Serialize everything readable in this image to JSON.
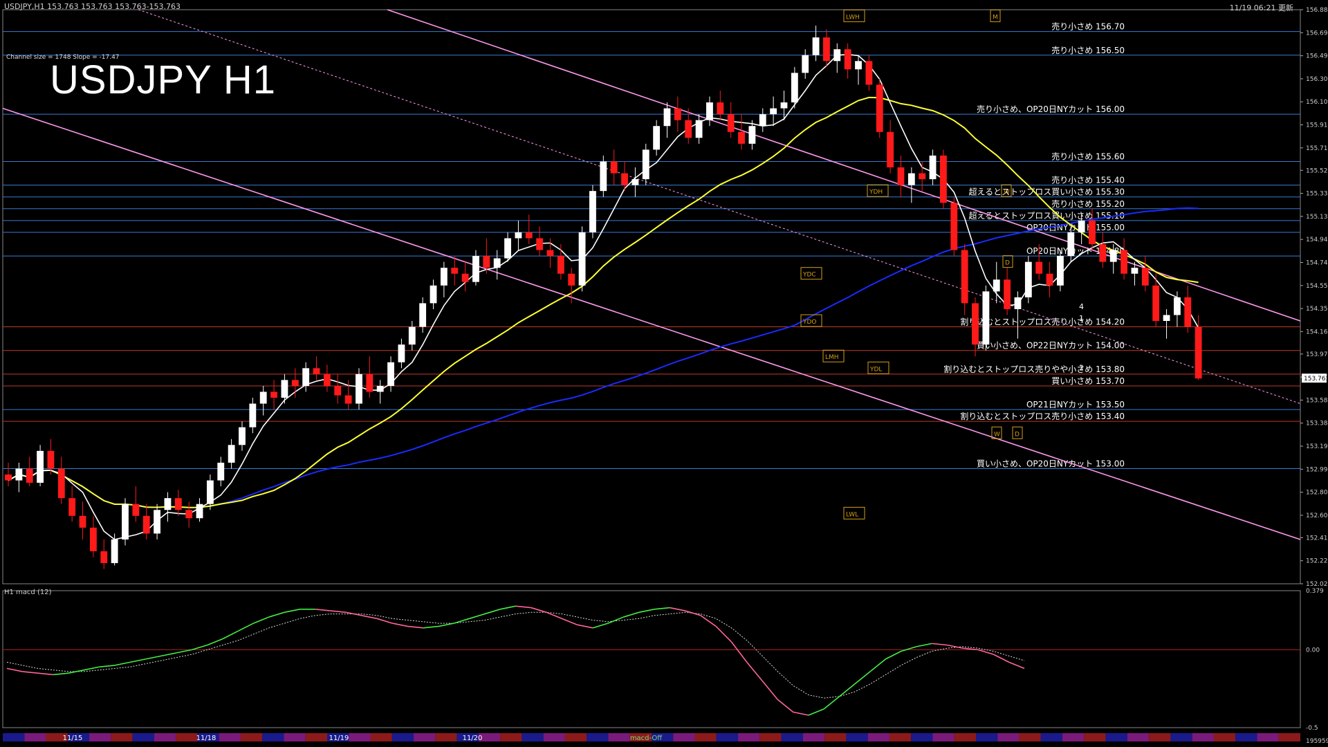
{
  "header": {
    "symbol_info": "USDJPY,H1  153.763 153.763 153.763-153.763",
    "timestamp": "11/19 06:21 更新"
  },
  "overlay": {
    "title": "USDJPY H1",
    "channel_info": "Channel size = 1748 Slope = -17.47"
  },
  "macd_title": "H1  macd (12)",
  "colors": {
    "background": "#000000",
    "bull_candle": "#ffffff",
    "bear_candle": "#ff1a1a",
    "sma_white": "#ffffff",
    "sma_yellow": "#ffff33",
    "sma_blue": "#1a2bff",
    "chikou_green": "#22cc22",
    "channel": "#ff99ee",
    "level_line": "#3a7bd5",
    "level_red": "#c0392b",
    "macd_up": "#44ee44",
    "macd_down": "#ff6699"
  },
  "chart_data": {
    "type": "candlestick",
    "symbol": "USDJPY",
    "timeframe": "H1",
    "ylim": [
      152.025,
      156.885
    ],
    "y_ticks": [
      "156.885",
      "156.690",
      "156.495",
      "156.300",
      "156.105",
      "155.910",
      "155.715",
      "155.525",
      "155.330",
      "155.135",
      "154.940",
      "154.745",
      "154.550",
      "154.355",
      "154.160",
      "153.970",
      "153.775",
      "153.580",
      "153.385",
      "153.190",
      "152.995",
      "152.800",
      "152.605",
      "152.415",
      "152.220",
      "152.025"
    ],
    "current_price": "153.763",
    "x_labels": [
      "11/15",
      "11/18",
      "11/19",
      "11/20"
    ],
    "levels": [
      {
        "price": 156.7,
        "label": "売り小さめ 156.70"
      },
      {
        "price": 156.5,
        "label": "売り小さめ 156.50"
      },
      {
        "price": 156.0,
        "label": "売り小さめ、OP20日NYカット 156.00"
      },
      {
        "price": 155.6,
        "label": "売り小さめ 155.60"
      },
      {
        "price": 155.4,
        "label": "売り小さめ 155.40"
      },
      {
        "price": 155.3,
        "label": "超えるとストップロス買い小さめ 155.30"
      },
      {
        "price": 155.2,
        "label": "売り小さめ 155.20"
      },
      {
        "price": 155.1,
        "label": "超えるとストップロス買い小さめ 155.10"
      },
      {
        "price": 155.0,
        "label": "OP20日NYカット 155.00"
      },
      {
        "price": 154.8,
        "label": "OP20日NYカット 154.80"
      },
      {
        "price": 154.2,
        "label": "割り込むとストップロス売り小さめ 154.20"
      },
      {
        "price": 154.0,
        "label": "買い小さめ、OP22日NYカット 154.00"
      },
      {
        "price": 153.8,
        "label": "割り込むとストップロス売りやや小さめ 153.80"
      },
      {
        "price": 153.7,
        "label": "買い小さめ 153.70"
      },
      {
        "price": 153.5,
        "label": "OP21日NYカット 153.50"
      },
      {
        "price": 153.4,
        "label": "割り込むとストップロス売り小さめ 153.40"
      },
      {
        "price": 153.0,
        "label": "買い小さめ、OP20日NYカット 153.00"
      }
    ],
    "markers": [
      {
        "text": "LWH",
        "price": 156.83
      },
      {
        "text": "M",
        "price": 156.83
      },
      {
        "text": "YDH",
        "price": 155.35
      },
      {
        "text": "W",
        "price": 155.35
      },
      {
        "text": "YDC",
        "price": 154.65
      },
      {
        "text": "YDO",
        "price": 154.25
      },
      {
        "text": "LMH",
        "price": 153.95
      },
      {
        "text": "YDL",
        "price": 153.85
      },
      {
        "text": "W",
        "price": 153.3
      },
      {
        "text": "D",
        "price": 153.3
      },
      {
        "text": "D",
        "price": 154.75
      },
      {
        "text": "LWL",
        "price": 152.62
      }
    ],
    "side_numbers": [
      "4",
      "1",
      "2"
    ],
    "candles": [
      [
        152.95,
        153.05,
        152.85,
        152.9
      ],
      [
        152.9,
        153.05,
        152.8,
        153.0
      ],
      [
        153.0,
        153.1,
        152.85,
        152.88
      ],
      [
        152.88,
        153.2,
        152.85,
        153.15
      ],
      [
        153.15,
        153.25,
        152.95,
        153.0
      ],
      [
        153.0,
        153.1,
        152.7,
        152.75
      ],
      [
        152.75,
        152.85,
        152.55,
        152.6
      ],
      [
        152.6,
        152.72,
        152.4,
        152.5
      ],
      [
        152.5,
        152.6,
        152.25,
        152.3
      ],
      [
        152.3,
        152.4,
        152.15,
        152.2
      ],
      [
        152.2,
        152.45,
        152.18,
        152.4
      ],
      [
        152.4,
        152.75,
        152.35,
        152.7
      ],
      [
        152.7,
        152.85,
        152.55,
        152.6
      ],
      [
        152.6,
        152.7,
        152.4,
        152.45
      ],
      [
        152.45,
        152.7,
        152.4,
        152.65
      ],
      [
        152.65,
        152.8,
        152.55,
        152.75
      ],
      [
        152.75,
        152.82,
        152.6,
        152.65
      ],
      [
        152.65,
        152.72,
        152.5,
        152.58
      ],
      [
        152.58,
        152.75,
        152.55,
        152.7
      ],
      [
        152.7,
        152.95,
        152.65,
        152.9
      ],
      [
        152.9,
        153.1,
        152.85,
        153.05
      ],
      [
        153.05,
        153.25,
        153.0,
        153.2
      ],
      [
        153.2,
        153.4,
        153.15,
        153.35
      ],
      [
        153.35,
        153.6,
        153.3,
        153.55
      ],
      [
        153.55,
        153.7,
        153.45,
        153.65
      ],
      [
        153.65,
        153.75,
        153.5,
        153.6
      ],
      [
        153.6,
        153.8,
        153.55,
        153.75
      ],
      [
        153.75,
        153.85,
        153.6,
        153.7
      ],
      [
        153.7,
        153.9,
        153.65,
        153.85
      ],
      [
        153.85,
        153.95,
        153.75,
        153.8
      ],
      [
        153.8,
        153.88,
        153.65,
        153.7
      ],
      [
        153.7,
        153.8,
        153.55,
        153.62
      ],
      [
        153.62,
        153.75,
        153.5,
        153.55
      ],
      [
        153.55,
        153.85,
        153.5,
        153.8
      ],
      [
        153.8,
        153.95,
        153.6,
        153.65
      ],
      [
        153.65,
        153.75,
        153.55,
        153.7
      ],
      [
        153.7,
        153.95,
        153.65,
        153.9
      ],
      [
        153.9,
        154.1,
        153.85,
        154.05
      ],
      [
        154.05,
        154.25,
        154.0,
        154.2
      ],
      [
        154.2,
        154.45,
        154.15,
        154.4
      ],
      [
        154.4,
        154.6,
        154.35,
        154.55
      ],
      [
        154.55,
        154.75,
        154.45,
        154.7
      ],
      [
        154.7,
        154.8,
        154.55,
        154.65
      ],
      [
        154.65,
        154.75,
        154.5,
        154.58
      ],
      [
        154.58,
        154.85,
        154.55,
        154.8
      ],
      [
        154.8,
        154.95,
        154.65,
        154.7
      ],
      [
        154.7,
        154.85,
        154.6,
        154.78
      ],
      [
        154.78,
        155.0,
        154.75,
        154.95
      ],
      [
        154.95,
        155.1,
        154.85,
        155.0
      ],
      [
        155.0,
        155.15,
        154.9,
        154.95
      ],
      [
        154.95,
        155.05,
        154.8,
        154.85
      ],
      [
        154.85,
        154.95,
        154.7,
        154.8
      ],
      [
        154.8,
        154.9,
        154.6,
        154.65
      ],
      [
        154.65,
        154.7,
        154.4,
        154.55
      ],
      [
        154.55,
        155.05,
        154.5,
        155.0
      ],
      [
        155.0,
        155.4,
        154.95,
        155.35
      ],
      [
        155.35,
        155.65,
        155.3,
        155.6
      ],
      [
        155.6,
        155.7,
        155.4,
        155.5
      ],
      [
        155.5,
        155.6,
        155.35,
        155.4
      ],
      [
        155.4,
        155.55,
        155.3,
        155.45
      ],
      [
        155.45,
        155.75,
        155.4,
        155.7
      ],
      [
        155.7,
        155.95,
        155.65,
        155.9
      ],
      [
        155.9,
        156.1,
        155.8,
        156.05
      ],
      [
        156.05,
        156.15,
        155.85,
        155.95
      ],
      [
        155.95,
        156.05,
        155.75,
        155.8
      ],
      [
        155.8,
        156.0,
        155.75,
        155.95
      ],
      [
        155.95,
        156.15,
        155.9,
        156.1
      ],
      [
        156.1,
        156.2,
        155.95,
        156.0
      ],
      [
        156.0,
        156.1,
        155.8,
        155.85
      ],
      [
        155.85,
        156.0,
        155.7,
        155.75
      ],
      [
        155.75,
        155.95,
        155.7,
        155.9
      ],
      [
        155.9,
        156.05,
        155.85,
        156.0
      ],
      [
        156.0,
        156.15,
        155.9,
        156.05
      ],
      [
        156.05,
        156.2,
        155.95,
        156.1
      ],
      [
        156.1,
        156.4,
        156.05,
        156.35
      ],
      [
        156.35,
        156.55,
        156.3,
        156.5
      ],
      [
        156.5,
        156.75,
        156.45,
        156.65
      ],
      [
        156.65,
        156.72,
        156.4,
        156.45
      ],
      [
        156.45,
        156.6,
        156.35,
        156.55
      ],
      [
        156.55,
        156.6,
        156.3,
        156.38
      ],
      [
        156.38,
        156.5,
        156.25,
        156.45
      ],
      [
        156.45,
        156.5,
        156.2,
        156.25
      ],
      [
        156.25,
        156.3,
        155.8,
        155.85
      ],
      [
        155.85,
        155.95,
        155.5,
        155.55
      ],
      [
        155.55,
        155.65,
        155.3,
        155.4
      ],
      [
        155.4,
        155.55,
        155.25,
        155.5
      ],
      [
        155.5,
        155.6,
        155.35,
        155.45
      ],
      [
        155.45,
        155.7,
        155.4,
        155.65
      ],
      [
        155.65,
        155.7,
        155.2,
        155.25
      ],
      [
        155.25,
        155.3,
        154.8,
        154.85
      ],
      [
        154.85,
        154.9,
        154.3,
        154.4
      ],
      [
        154.4,
        154.45,
        153.95,
        154.05
      ],
      [
        154.05,
        154.55,
        154.0,
        154.5
      ],
      [
        154.5,
        154.75,
        154.4,
        154.6
      ],
      [
        154.6,
        154.7,
        154.3,
        154.35
      ],
      [
        154.35,
        154.5,
        154.1,
        154.45
      ],
      [
        154.45,
        154.8,
        154.4,
        154.75
      ],
      [
        154.75,
        154.9,
        154.6,
        154.65
      ],
      [
        154.65,
        154.75,
        154.45,
        154.55
      ],
      [
        154.55,
        154.85,
        154.5,
        154.8
      ],
      [
        154.8,
        155.05,
        154.75,
        155.0
      ],
      [
        155.0,
        155.15,
        154.9,
        155.1
      ],
      [
        155.1,
        155.2,
        154.85,
        154.9
      ],
      [
        154.9,
        155.0,
        154.7,
        154.75
      ],
      [
        154.75,
        154.9,
        154.65,
        154.85
      ],
      [
        154.85,
        154.95,
        154.6,
        154.65
      ],
      [
        154.65,
        154.75,
        154.55,
        154.7
      ],
      [
        154.7,
        154.8,
        154.5,
        154.55
      ],
      [
        154.55,
        154.65,
        154.2,
        154.25
      ],
      [
        154.25,
        154.35,
        154.1,
        154.3
      ],
      [
        154.3,
        154.5,
        154.2,
        154.45
      ],
      [
        154.45,
        154.55,
        154.15,
        154.2
      ],
      [
        154.2,
        154.3,
        153.75,
        153.763
      ]
    ]
  },
  "macd": {
    "ylim": [
      -0.5,
      0.379
    ],
    "y_ticks": [
      "0.379",
      "0.00",
      "-0.5"
    ],
    "bottom_label": "195959",
    "values": [
      -0.12,
      -0.14,
      -0.15,
      -0.16,
      -0.15,
      -0.13,
      -0.11,
      -0.1,
      -0.08,
      -0.06,
      -0.04,
      -0.02,
      0.0,
      0.03,
      0.07,
      0.12,
      0.17,
      0.21,
      0.24,
      0.26,
      0.26,
      0.25,
      0.24,
      0.22,
      0.2,
      0.17,
      0.15,
      0.14,
      0.15,
      0.17,
      0.2,
      0.23,
      0.26,
      0.28,
      0.27,
      0.24,
      0.2,
      0.16,
      0.14,
      0.17,
      0.21,
      0.24,
      0.26,
      0.27,
      0.25,
      0.22,
      0.15,
      0.05,
      -0.08,
      -0.2,
      -0.32,
      -0.4,
      -0.42,
      -0.38,
      -0.3,
      -0.22,
      -0.14,
      -0.06,
      -0.01,
      0.02,
      0.04,
      0.03,
      0.01,
      0.0,
      -0.03,
      -0.08,
      -0.12
    ],
    "signal": [
      -0.08,
      -0.1,
      -0.12,
      -0.13,
      -0.14,
      -0.14,
      -0.13,
      -0.12,
      -0.11,
      -0.09,
      -0.07,
      -0.05,
      -0.03,
      0.0,
      0.03,
      0.06,
      0.1,
      0.14,
      0.17,
      0.2,
      0.22,
      0.23,
      0.23,
      0.23,
      0.22,
      0.2,
      0.19,
      0.18,
      0.17,
      0.17,
      0.18,
      0.19,
      0.21,
      0.23,
      0.24,
      0.24,
      0.23,
      0.21,
      0.19,
      0.18,
      0.19,
      0.2,
      0.22,
      0.23,
      0.24,
      0.23,
      0.2,
      0.14,
      0.06,
      -0.04,
      -0.14,
      -0.23,
      -0.29,
      -0.31,
      -0.3,
      -0.27,
      -0.22,
      -0.16,
      -0.1,
      -0.05,
      -0.01,
      0.01,
      0.02,
      0.01,
      -0.01,
      -0.04,
      -0.07
    ]
  },
  "timebar_label": "macd-Off"
}
